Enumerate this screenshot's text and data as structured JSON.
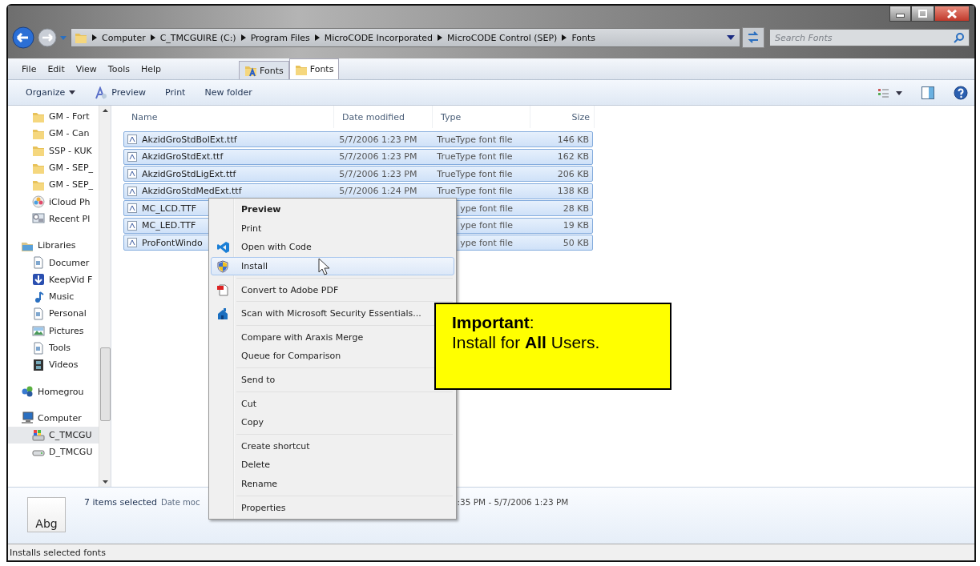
{
  "window": {
    "controls": [
      {
        "kind": "minimize"
      },
      {
        "kind": "maximize"
      },
      {
        "kind": "close"
      }
    ]
  },
  "address_bar": {
    "crumbs": [
      "Computer",
      "C_TMCGUIRE (C:)",
      "Program Files",
      "MicroCODE Incorporated",
      "MicroCODE Control (SEP)",
      "Fonts"
    ]
  },
  "search": {
    "placeholder": "Search Fonts"
  },
  "menu_bar": [
    "File",
    "Edit",
    "View",
    "Tools",
    "Help"
  ],
  "tabs": [
    {
      "label": "Fonts",
      "kind": "fontfolder",
      "selected": false
    },
    {
      "label": "Fonts",
      "kind": "folder",
      "selected": true
    }
  ],
  "toolbar": [
    {
      "label": "Organize",
      "kind": "dropdown"
    },
    {
      "label": "Preview",
      "kind": "preview"
    },
    {
      "label": "Print",
      "kind": "plain"
    },
    {
      "label": "New folder",
      "kind": "plain"
    }
  ],
  "sidebar": {
    "items": [
      {
        "label": "GM - Fort",
        "kind": "folder",
        "selected": false
      },
      {
        "label": "GM - Can",
        "kind": "folder",
        "selected": false
      },
      {
        "label": "SSP - KUK",
        "kind": "folder",
        "selected": false
      },
      {
        "label": "GM - SEP_",
        "kind": "folder",
        "selected": false
      },
      {
        "label": "GM - SEP_",
        "kind": "folder",
        "selected": false
      },
      {
        "label": "iCloud Ph",
        "kind": "photos",
        "selected": false
      },
      {
        "label": "Recent Pl",
        "kind": "recent",
        "selected": false
      },
      {
        "label": "Libraries",
        "kind": "library",
        "selected": false,
        "children": [
          {
            "label": "Documer",
            "kind": "document",
            "selected": false
          },
          {
            "label": "KeepVid F",
            "kind": "download",
            "selected": false
          },
          {
            "label": "Music",
            "kind": "music",
            "selected": false
          },
          {
            "label": "Personal",
            "kind": "document",
            "selected": false
          },
          {
            "label": "Pictures",
            "kind": "pictures",
            "selected": false
          },
          {
            "label": "Tools",
            "kind": "document",
            "selected": false
          },
          {
            "label": "Videos",
            "kind": "videos",
            "selected": false
          }
        ]
      },
      {
        "label": "Homegrou",
        "kind": "homegroup",
        "selected": false
      },
      {
        "label": "Computer",
        "kind": "computer",
        "selected": false,
        "children": [
          {
            "label": "C_TMCGU",
            "kind": "osdrive",
            "selected": true
          },
          {
            "label": "D_TMCGU",
            "kind": "drive",
            "selected": false
          }
        ]
      }
    ]
  },
  "table": {
    "columns": [
      "Name",
      "Date modified",
      "Type",
      "Size"
    ],
    "rows": [
      {
        "name": "AkzidGroStdBolExt.ttf",
        "date": "5/7/2006 1:23 PM",
        "type": "TrueType font file",
        "size": "146 KB",
        "selected": true
      },
      {
        "name": "AkzidGroStdExt.ttf",
        "date": "5/7/2006 1:23 PM",
        "type": "TrueType font file",
        "size": "162 KB",
        "selected": true
      },
      {
        "name": "AkzidGroStdLigExt.ttf",
        "date": "5/7/2006 1:23 PM",
        "type": "TrueType font file",
        "size": "206 KB",
        "selected": true
      },
      {
        "name": "AkzidGroStdMedExt.ttf",
        "date": "5/7/2006 1:24 PM",
        "type": "TrueType font file",
        "size": "138 KB",
        "selected": true
      },
      {
        "name": "MC_LCD.TTF",
        "type": "ype font file",
        "size": "28 KB",
        "selected": true
      },
      {
        "name": "MC_LED.TTF",
        "type": "ype font file",
        "size": "19 KB",
        "selected": true
      },
      {
        "name": "ProFontWindo",
        "type": "ype font file",
        "size": "50 KB",
        "selected": true
      }
    ]
  },
  "details": {
    "thumbnail": "Abg",
    "title": "7 items selected",
    "date_label": "Date moc",
    "date_value": ":35 PM - 5/7/2006 1:23 PM"
  },
  "status_bar": "Installs selected fonts",
  "context_menu": [
    {
      "label": "Preview",
      "kind": "none",
      "bold": true,
      "selected": false
    },
    {
      "label": "Print",
      "kind": "none",
      "bold": false,
      "selected": false
    },
    {
      "label": "Open with Code",
      "kind": "code",
      "bold": false,
      "selected": false
    },
    {
      "label": "Install",
      "kind": "shield",
      "bold": false,
      "selected": true
    },
    {
      "kind": "separator"
    },
    {
      "label": "Convert to Adobe PDF",
      "kind": "pdf",
      "bold": false,
      "selected": false
    },
    {
      "kind": "separator"
    },
    {
      "label": "Scan with Microsoft Security Essentials...",
      "kind": "scan",
      "bold": false,
      "selected": false
    },
    {
      "kind": "separator"
    },
    {
      "label": "Compare with Araxis Merge",
      "kind": "none",
      "bold": false,
      "selected": false
    },
    {
      "label": "Queue for Comparison",
      "kind": "none",
      "bold": false,
      "selected": false
    },
    {
      "kind": "separator"
    },
    {
      "label": "Send to",
      "kind": "none",
      "bold": false,
      "selected": false
    },
    {
      "kind": "separator"
    },
    {
      "label": "Cut",
      "kind": "none",
      "bold": false,
      "selected": false
    },
    {
      "label": "Copy",
      "kind": "none",
      "bold": false,
      "selected": false
    },
    {
      "kind": "separator"
    },
    {
      "label": "Create shortcut",
      "kind": "none",
      "bold": false,
      "selected": false
    },
    {
      "label": "Delete",
      "kind": "none",
      "bold": false,
      "selected": false
    },
    {
      "label": "Rename",
      "kind": "none",
      "bold": false,
      "selected": false
    },
    {
      "kind": "separator"
    },
    {
      "label": "Properties",
      "kind": "none",
      "bold": false,
      "selected": false
    }
  ],
  "callout": {
    "lines": [
      "**Important**:",
      "Install for **All** Users."
    ]
  }
}
